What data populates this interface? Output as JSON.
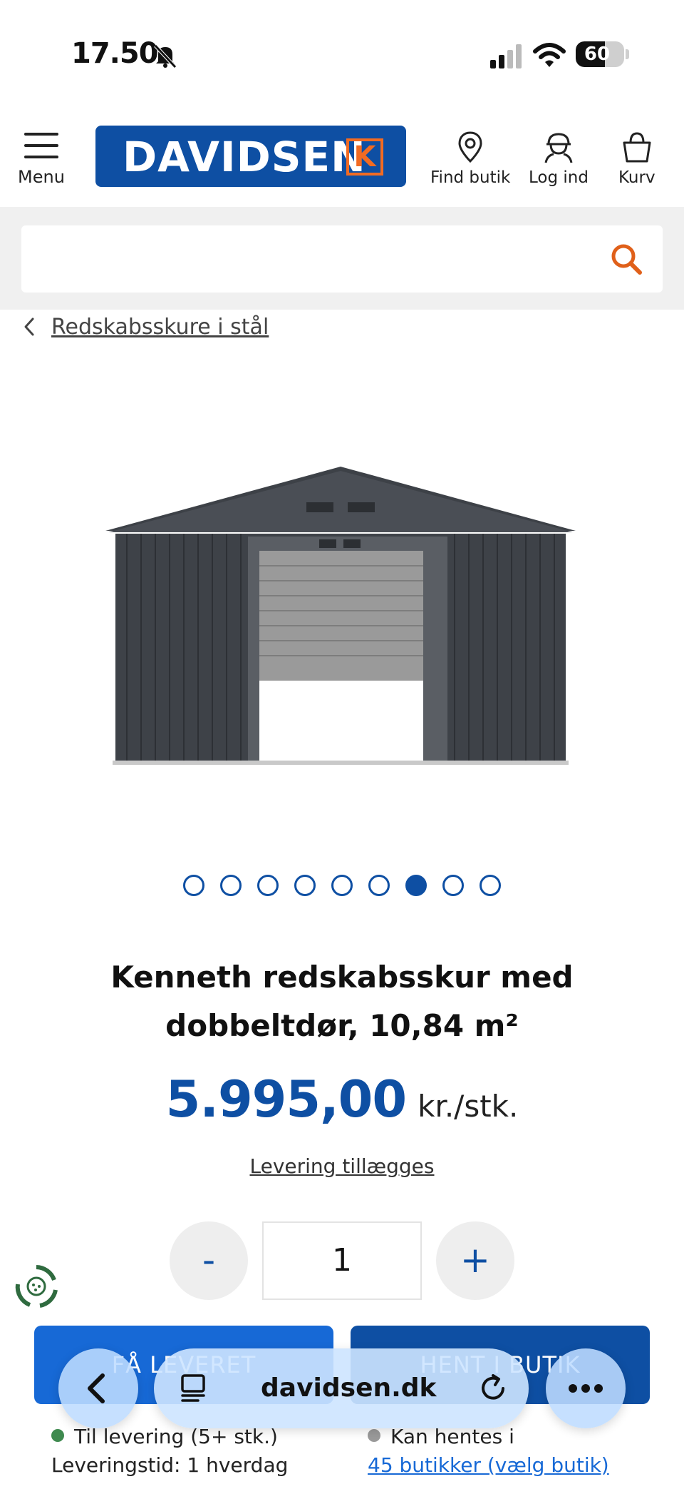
{
  "status": {
    "time": "17.50",
    "battery": "60",
    "battery_level": 0.6
  },
  "header": {
    "menu_label": "Menu",
    "brand": "DAVIDSEN",
    "brand_k": "K",
    "find_store_label": "Find butik",
    "login_label": "Log ind",
    "cart_label": "Kurv"
  },
  "search": {
    "placeholder": ""
  },
  "breadcrumb": {
    "label": "Redskabsskure i stål"
  },
  "carousel": {
    "count": 9,
    "active_index": 6
  },
  "product": {
    "title": "Kenneth redskabsskur med dobbeltdør, 10,84 m²",
    "price": "5.995,00",
    "price_unit": "kr./stk.",
    "delivery_link": "Levering tillægges",
    "quantity": "1",
    "minus": "-",
    "plus": "+"
  },
  "buttons": {
    "deliver": "FÅ LEVERET",
    "pickup": "HENT I BUTIK"
  },
  "availability": {
    "delivery_line1": "Til levering (5+ stk.)",
    "delivery_line2": "Leveringstid: 1 hverdag",
    "pickup_line1": "Kan hentes i",
    "pickup_link": "45 butikker (vælg butik)"
  },
  "browser": {
    "url": "davidsen.dk"
  },
  "colors": {
    "brand_blue": "#0e4fa3",
    "accent_orange": "#f26b22",
    "button_blue": "#1769d6",
    "in_stock": "#3f8a4f",
    "pickup_grey": "#9a9a9a"
  }
}
